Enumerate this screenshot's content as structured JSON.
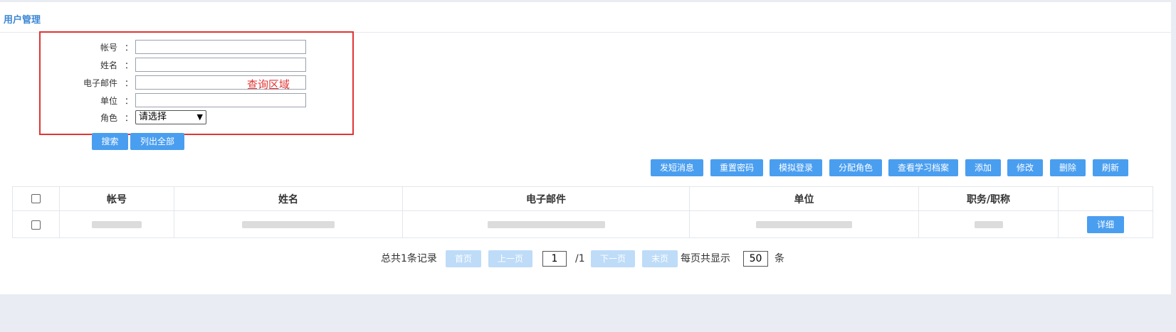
{
  "panel": {
    "title": "用户管理"
  },
  "query": {
    "hint": "查询区域",
    "colon": "：",
    "fields": [
      {
        "label": "帐号",
        "value": ""
      },
      {
        "label": "姓名",
        "value": ""
      },
      {
        "label": "电子邮件",
        "value": ""
      },
      {
        "label": "单位",
        "value": ""
      }
    ],
    "role": {
      "label": "角色",
      "value": "请选择"
    },
    "search_label": "搜索",
    "list_all_label": "列出全部"
  },
  "toolbar": [
    "发短消息",
    "重置密码",
    "模拟登录",
    "分配角色",
    "查看学习档案",
    "添加",
    "修改",
    "删除",
    "刷新"
  ],
  "table": {
    "headers": [
      "帐号",
      "姓名",
      "电子邮件",
      "单位",
      "职务/职称"
    ],
    "rows": [
      {
        "detail_label": "详细"
      }
    ]
  },
  "pager": {
    "total": "总共1条记录",
    "first": "首页",
    "prev": "上一页",
    "page": "1",
    "of": "/1",
    "next": "下一页",
    "last": "末页",
    "per_page_label": "每页共显示",
    "per_page": "50",
    "unit": "条"
  },
  "colors": {
    "accent": "#4a9ef0",
    "highlight": "#e03434",
    "disabled": "#bedcf8"
  }
}
